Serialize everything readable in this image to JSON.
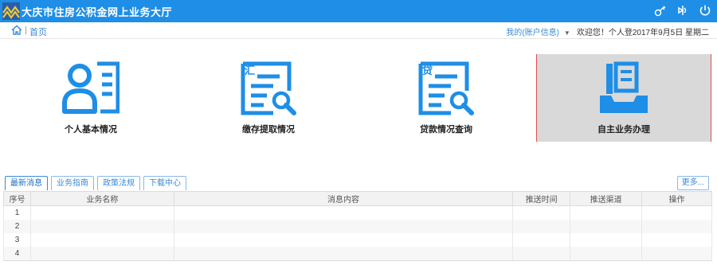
{
  "header": {
    "title": "大庆市住房公积金网上业务大厅",
    "icons": [
      "key-icon",
      "back-icon",
      "power-icon"
    ],
    "brand_color": "#1e8ee6"
  },
  "nav": {
    "breadcrumb": "首页",
    "account_link": "我的(账户信息)",
    "welcome": "欢迎您！个人登2017年9月5日 星期二"
  },
  "tiles": [
    {
      "label": "个人基本情况",
      "icon": "person-profile-icon"
    },
    {
      "label": "缴存提取情况",
      "icon": "deposit-search-icon",
      "badge": "汇"
    },
    {
      "label": "贷款情况查询",
      "icon": "loan-search-icon",
      "badge": "贷"
    },
    {
      "label": "自主业务办理",
      "icon": "inbox-document-icon",
      "selected": true
    }
  ],
  "tabs": {
    "items": [
      "最新消息",
      "业务指南",
      "政策法规",
      "下载中心"
    ],
    "active_index": 0,
    "more_label": "更多..."
  },
  "table": {
    "columns": [
      "序号",
      "业务名称",
      "消息内容",
      "推送时间",
      "推送渠道",
      "操作"
    ],
    "rows": [
      {
        "num": "1"
      },
      {
        "num": "2"
      },
      {
        "num": "3"
      },
      {
        "num": "4"
      }
    ]
  }
}
